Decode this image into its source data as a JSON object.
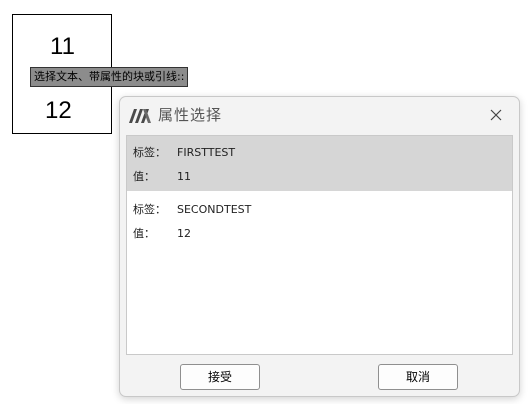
{
  "drawing": {
    "top_text": "11",
    "bottom_text": "12",
    "prompt": "选择文本、带属性的块或引线::"
  },
  "dialog": {
    "title": "属性选择",
    "app_icon": "app-logo-icon",
    "close_icon": "close-icon",
    "records": [
      {
        "tag_label": "标签：",
        "tag_value": "FIRSTTEST",
        "value_label": "值：",
        "value": "11",
        "selected": true
      },
      {
        "tag_label": "标签：",
        "tag_value": "SECONDTEST",
        "value_label": "值：",
        "value": "12",
        "selected": false
      }
    ],
    "accept_label": "接受",
    "cancel_label": "取消"
  },
  "colors": {
    "selected_row": "#d6d6d6",
    "dialog_bg": "#f3f3f3",
    "prompt_bg": "#8c8c8c"
  }
}
